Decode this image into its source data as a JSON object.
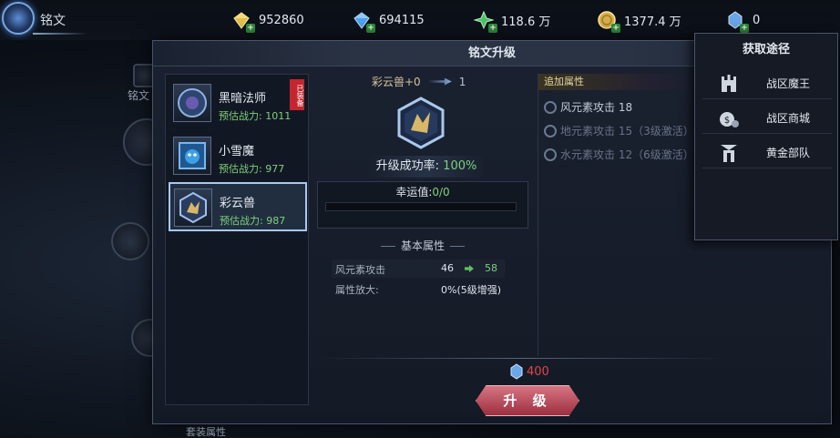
{
  "window": {
    "title": "铭文"
  },
  "resources": [
    {
      "name": "gold-diamond",
      "value": "952860",
      "icon": "gold-diamond-icon",
      "color": "#e5c04a"
    },
    {
      "name": "blue-diamond",
      "value": "694115",
      "icon": "blue-diamond-icon",
      "color": "#4fa3f0"
    },
    {
      "name": "green-crystal",
      "value": "118.6 万",
      "icon": "green-crystal-icon",
      "color": "#4cc46a"
    },
    {
      "name": "gold-coin",
      "value": "1377.4 万",
      "icon": "gold-coin-icon",
      "color": "#d9b04a"
    },
    {
      "name": "rune-stone",
      "value": "0",
      "icon": "rune-stone-icon",
      "color": "#6aa6e8"
    }
  ],
  "background": {
    "side_label": "铭文"
  },
  "dialog": {
    "title": "铭文升级",
    "list": [
      {
        "name": "黑暗法师",
        "power": "预估战力: 1011",
        "equipped_tag": "已装备",
        "selected": false
      },
      {
        "name": "小雪魔",
        "power": "预估战力: 977",
        "selected": false
      },
      {
        "name": "彩云兽",
        "power": "预估战力: 987",
        "selected": true
      }
    ],
    "upgrade": {
      "rune_name": "彩云兽+0",
      "next_level": "1",
      "rate_label": "升级成功率:",
      "rate_value": "100%",
      "luck_label": "幸运值:",
      "luck_value": "0/0",
      "luck_progress": 0
    },
    "basic_attrs": {
      "title": "基本属性",
      "rows": [
        {
          "name": "风元素攻击",
          "current": "46",
          "next": "58"
        },
        {
          "name": "属性放大:",
          "amplify": "0%(5级增强)"
        }
      ]
    },
    "extra_attrs": {
      "title": "追加属性",
      "rows": [
        {
          "text": "风元素攻击 18",
          "active": true
        },
        {
          "text": "地元素攻击 15（3级激活）",
          "active": false
        },
        {
          "text": "水元素攻击 12（6级激活）",
          "active": false
        }
      ]
    },
    "cost": {
      "value": "400",
      "color": "#e0444a"
    },
    "upgrade_button": "升 级"
  },
  "acquire_popup": {
    "title": "获取途径",
    "items": [
      {
        "label": "战区魔王",
        "icon": "castle-icon"
      },
      {
        "label": "战区商城",
        "icon": "coin-bag-icon"
      },
      {
        "label": "黄金部队",
        "icon": "banner-icon"
      }
    ]
  },
  "footer_label": "套装属性"
}
